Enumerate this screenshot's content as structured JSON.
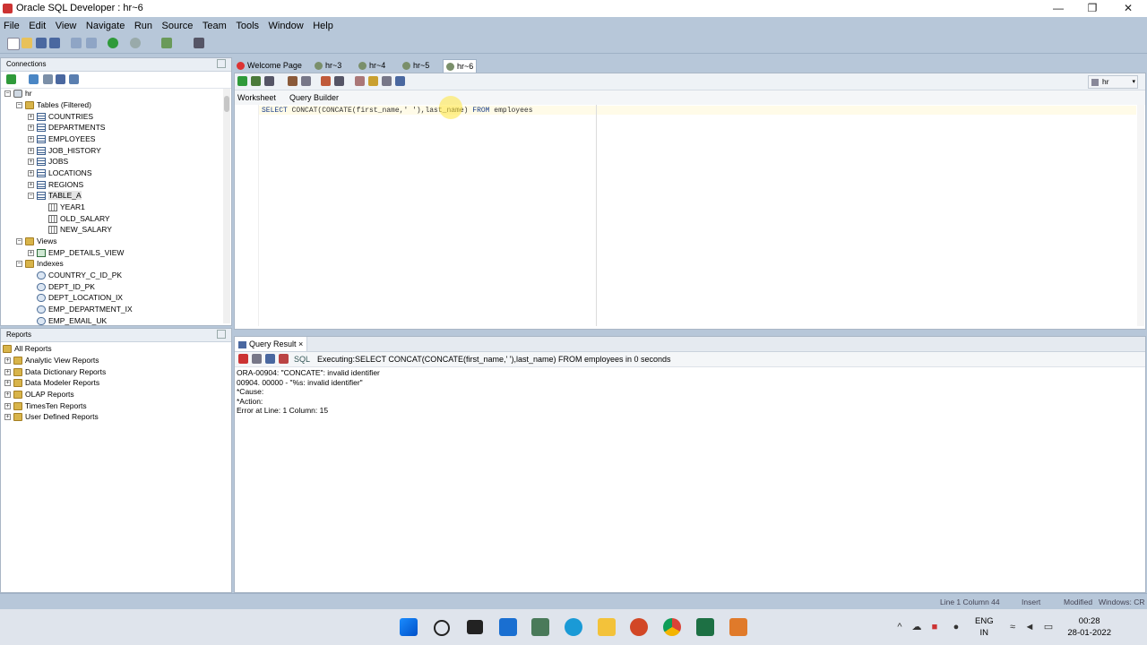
{
  "window": {
    "title": "Oracle SQL Developer : hr~6",
    "controls": [
      "—",
      "❐",
      "✕"
    ]
  },
  "menu": [
    "File",
    "Edit",
    "View",
    "Navigate",
    "Run",
    "Source",
    "Team",
    "Tools",
    "Window",
    "Help"
  ],
  "connections": {
    "title": "Connections",
    "root": "hr",
    "tables_label": "Tables (Filtered)",
    "tables": [
      "COUNTRIES",
      "DEPARTMENTS",
      "EMPLOYEES",
      "JOB_HISTORY",
      "JOBS",
      "LOCATIONS",
      "REGIONS",
      "TABLE_A"
    ],
    "table_a_columns": [
      "YEAR1",
      "OLD_SALARY",
      "NEW_SALARY"
    ],
    "views_label": "Views",
    "views": [
      "EMP_DETAILS_VIEW"
    ],
    "indexes_label": "Indexes",
    "indexes": [
      "COUNTRY_C_ID_PK",
      "DEPT_ID_PK",
      "DEPT_LOCATION_IX",
      "EMP_DEPARTMENT_IX",
      "EMP_EMAIL_UK"
    ]
  },
  "reports": {
    "title": "Reports",
    "items": [
      "All Reports",
      "Analytic View Reports",
      "Data Dictionary Reports",
      "Data Modeler Reports",
      "OLAP Reports",
      "TimesTen Reports",
      "User Defined Reports"
    ]
  },
  "editor": {
    "tabs": [
      "Welcome Page",
      "hr~3",
      "hr~4",
      "hr~5",
      "hr~6"
    ],
    "active_tab": "hr~6",
    "connection_selector": "hr",
    "subtabs": [
      "Worksheet",
      "Query Builder"
    ],
    "code_keyword_1": "SELECT",
    "code_mid": "CONCAT(CONCATE(first_name,' '),last_name)",
    "code_keyword_2": "FROM",
    "code_tail": "employees"
  },
  "result": {
    "tab_label": "Query Result",
    "tab_close": "×",
    "sql_label": "SQL",
    "executing": "Executing:SELECT CONCAT(CONCATE(first_name,' '),last_name) FROM employees in 0 seconds",
    "lines": [
      "ORA-00904: \"CONCATE\": invalid identifier",
      "00904. 00000 -  \"%s: invalid identifier\"",
      "*Cause:",
      "*Action:",
      "Error at Line: 1 Column: 15"
    ]
  },
  "status": {
    "position": "Line 1 Column 44",
    "mode": "Insert",
    "modified": "Modified",
    "eol": "Windows: CR"
  },
  "taskbar": {
    "lang_top": "ENG",
    "lang_bottom": "IN",
    "time": "00:28",
    "date": "28-01-2022"
  },
  "colors": {
    "chrome": "#b7c7d9",
    "keyword": "#1a3e8a"
  }
}
